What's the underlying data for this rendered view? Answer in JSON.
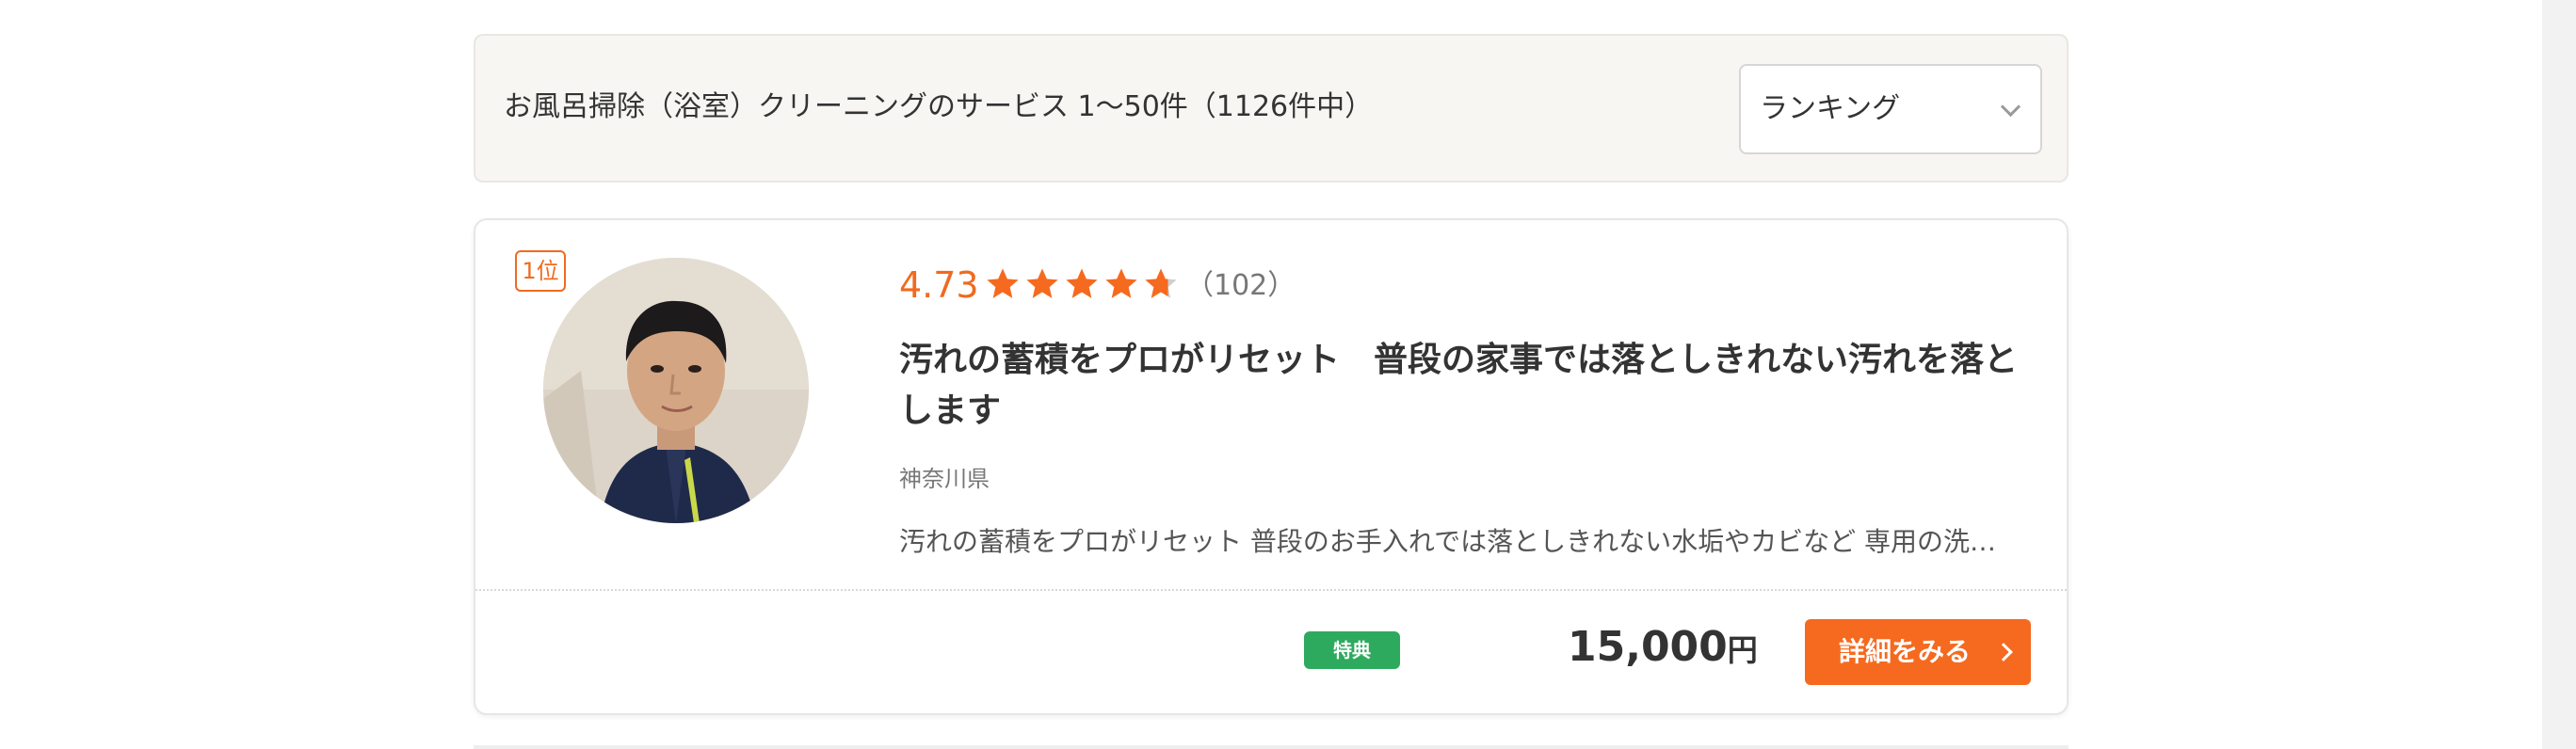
{
  "results_header": {
    "summary": "お風呂掃除（浴室）クリーニングのサービス 1〜50件（1126件中）",
    "sort": {
      "selected": "ランキング"
    }
  },
  "listing": {
    "rank": "1位",
    "rating": "4.73",
    "rating_numeric": 4.73,
    "review_count": "（102）",
    "title": "汚れの蓄積をプロがリセット　普段の家事では落としきれない汚れを落とします",
    "location": "神奈川県",
    "description": "汚れの蓄積をプロがリセット 普段のお手入れでは落としきれない水垢やカビなど 専用の洗…",
    "perk_badge": "特典",
    "price": "15,000",
    "price_unit": "円",
    "detail_button": "詳細をみる"
  },
  "colors": {
    "accent_orange": "#f56a1f",
    "perk_green": "#2eaa5e"
  },
  "icons": {
    "star": "star-icon",
    "sort_chevron": "chevron-down-icon",
    "button_chevron": "chevron-right-icon"
  }
}
